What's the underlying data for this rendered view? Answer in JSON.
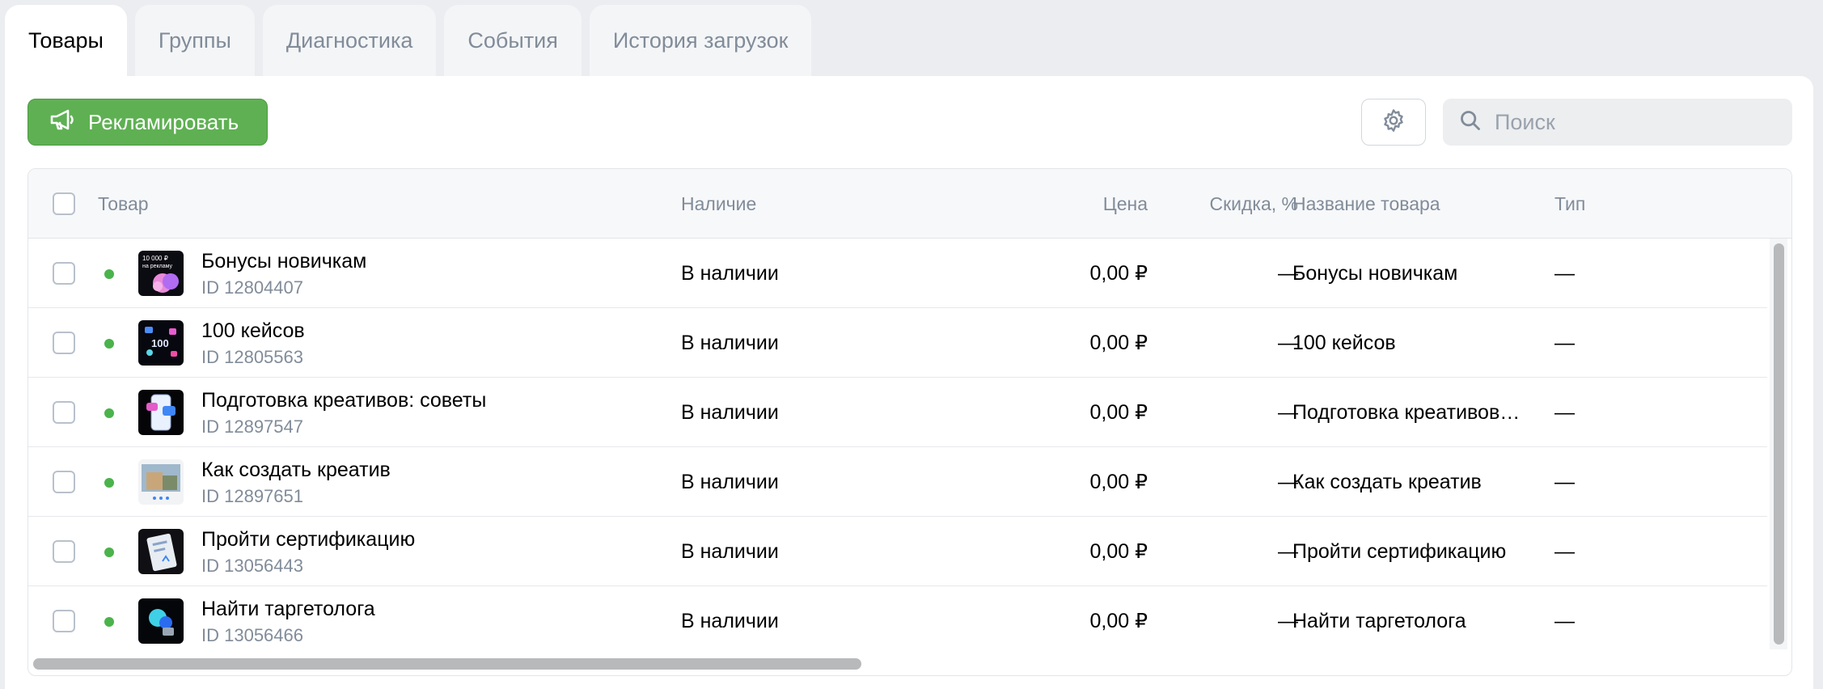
{
  "tabs": [
    {
      "label": "Товары",
      "active": true
    },
    {
      "label": "Группы"
    },
    {
      "label": "Диагностика"
    },
    {
      "label": "События"
    },
    {
      "label": "История загрузок"
    }
  ],
  "toolbar": {
    "promote_label": "Рекламировать",
    "search_placeholder": "Поиск",
    "accent_color": "#5fb053"
  },
  "table": {
    "columns": {
      "product": "Товар",
      "availability": "Наличие",
      "price": "Цена",
      "discount": "Скидка, %",
      "product_name": "Название товара",
      "type": "Тип"
    },
    "rows": [
      {
        "name": "Бонусы новичкам",
        "id": "ID 12804407",
        "availability": "В наличии",
        "price": "0,00 ₽",
        "discount": "—",
        "product_name": "Бонусы новичкам",
        "type": "—",
        "thumb_text": "10 000 ₽ на рекламу"
      },
      {
        "name": "100 кейсов",
        "id": "ID 12805563",
        "availability": "В наличии",
        "price": "0,00 ₽",
        "discount": "—",
        "product_name": "100 кейсов",
        "type": "—",
        "thumb_text": "100"
      },
      {
        "name": "Подготовка креативов: советы",
        "id": "ID 12897547",
        "availability": "В наличии",
        "price": "0,00 ₽",
        "discount": "—",
        "product_name": "Подготовка креативов…",
        "type": "—"
      },
      {
        "name": "Как создать креатив",
        "id": "ID 12897651",
        "availability": "В наличии",
        "price": "0,00 ₽",
        "discount": "—",
        "product_name": "Как создать креатив",
        "type": "—"
      },
      {
        "name": "Пройти сертификацию",
        "id": "ID 13056443",
        "availability": "В наличии",
        "price": "0,00 ₽",
        "discount": "—",
        "product_name": "Пройти сертификацию",
        "type": "—"
      },
      {
        "name": "Найти таргетолога",
        "id": "ID 13056466",
        "availability": "В наличии",
        "price": "0,00 ₽",
        "discount": "—",
        "product_name": "Найти таргетолога",
        "type": "—"
      }
    ]
  }
}
